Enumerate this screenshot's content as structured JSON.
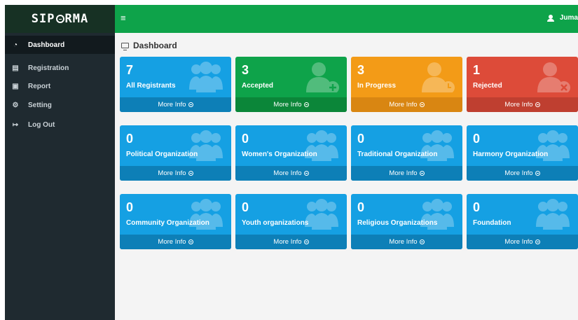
{
  "brand": "SIP⊝RMA",
  "brand_parts": [
    "SIP",
    "RMA"
  ],
  "topbar": {
    "user_name": "Juma"
  },
  "sidebar": {
    "items": [
      {
        "label": "Dashboard",
        "icon": "dashboard-icon",
        "active": true
      },
      {
        "label": "Registration",
        "icon": "clipboard-icon"
      },
      {
        "label": "Report",
        "icon": "report-icon"
      },
      {
        "label": "Setting",
        "icon": "gear-icon"
      },
      {
        "label": "Log Out",
        "icon": "logout-icon"
      }
    ]
  },
  "page": {
    "title": "Dashboard"
  },
  "more_info_label": "More Info",
  "cards_row1": [
    {
      "count": "7",
      "label": "All Registrants",
      "color": "#15a0e3",
      "icon": "users-icon"
    },
    {
      "count": "3",
      "label": "Accepted",
      "color": "#0ea34a",
      "icon": "user-plus-icon"
    },
    {
      "count": "3",
      "label": "In Progress",
      "color": "#f39b17",
      "icon": "user-clock-icon"
    },
    {
      "count": "1",
      "label": "Rejected",
      "color": "#dd4b39",
      "icon": "user-times-icon"
    }
  ],
  "cards_row2": [
    {
      "count": "0",
      "label": "Political Organization"
    },
    {
      "count": "0",
      "label": "Women's Organization"
    },
    {
      "count": "0",
      "label": "Traditional Organization"
    },
    {
      "count": "0",
      "label": "Harmony Organization"
    }
  ],
  "cards_row3": [
    {
      "count": "0",
      "label": "Community Organization"
    },
    {
      "count": "0",
      "label": "Youth organizations"
    },
    {
      "count": "0",
      "label": "Religious Organizations"
    },
    {
      "count": "0",
      "label": "Foundation"
    }
  ]
}
